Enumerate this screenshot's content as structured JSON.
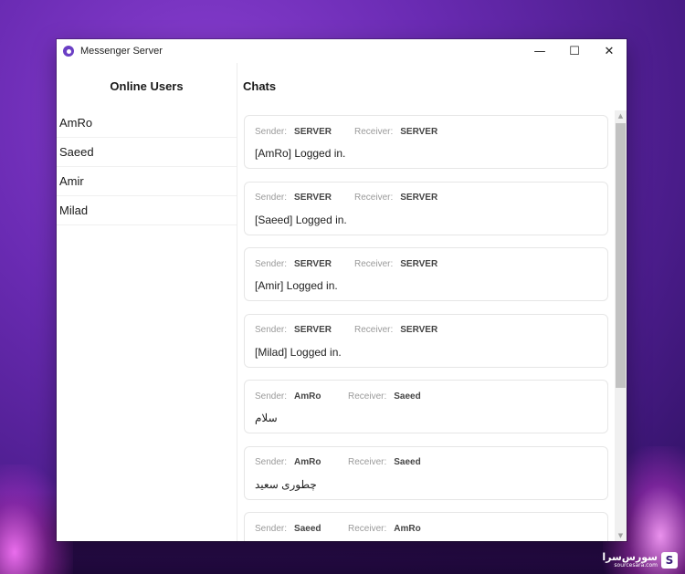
{
  "window": {
    "title": "Messenger Server",
    "controls": {
      "minimize": "—",
      "maximize": "☐",
      "close": "✕"
    }
  },
  "left_pane": {
    "header": "Online Users",
    "users": [
      "AmRo",
      "Saeed",
      "Amir",
      "Milad"
    ]
  },
  "right_pane": {
    "header": "Chats",
    "sender_label": "Sender:",
    "receiver_label": "Receiver:",
    "chats": [
      {
        "sender": "SERVER",
        "receiver": "SERVER",
        "message": "[AmRo] Logged in."
      },
      {
        "sender": "SERVER",
        "receiver": "SERVER",
        "message": "[Saeed] Logged in."
      },
      {
        "sender": "SERVER",
        "receiver": "SERVER",
        "message": "[Amir] Logged in."
      },
      {
        "sender": "SERVER",
        "receiver": "SERVER",
        "message": "[Milad] Logged in."
      },
      {
        "sender": "AmRo",
        "receiver": "Saeed",
        "message": "سلام"
      },
      {
        "sender": "AmRo",
        "receiver": "Saeed",
        "message": "چطوری سعید"
      },
      {
        "sender": "Saeed",
        "receiver": "AmRo",
        "message": ""
      }
    ]
  },
  "watermark": {
    "brand": "سورس‌سرا",
    "site": "sourcesara.com"
  },
  "colors": {
    "accent": "#6b3fc4",
    "background": "#6a2bb3"
  }
}
